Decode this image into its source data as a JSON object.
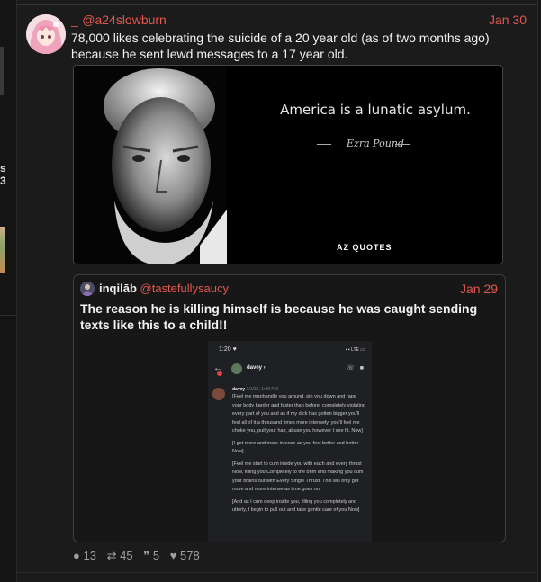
{
  "sidebar": {
    "fragment_lines": [
      "s",
      "3"
    ]
  },
  "post": {
    "prefix": "_",
    "handle": "@a24slowburn",
    "date": "Jan 30",
    "text": "78,000 likes celebrating the suicide of a 20 year old (as of two months ago) because he sent lewd messages to a 17 year old.",
    "image": {
      "quote": "America is a lunatic asylum.",
      "author": "Ezra Pound",
      "brand": "AZ QUOTES"
    }
  },
  "quoted": {
    "display_name": "inqilāb",
    "handle": "@tastefullysaucy",
    "date": "Jan 29",
    "text": "The reason he is killing himself is because he was caught sending texts like this to a child!!",
    "phone": {
      "time": "1:20",
      "network": "LTE",
      "contact": "davey",
      "sender": "davey",
      "timestamp": "1/1/25, 1:00 PM",
      "messages": [
        "[Feel me manhandle you around, pin you down and rape your body harder and faster than before, completely violating every part of you and as if my dick has gotten bigger you'll feel all of it a thousand times more intensely. you'll feel me choke you, pull your hair, abuse you however I see fit. Now]",
        "[I get more and more intense as you feel better and better Now]",
        "[Feel me start to cum inside you with each and every thrust Now, filling you Completely to the brim and making you cum your brains out with Every Single Thrust. This will only get more and more intense as time goes on]",
        "[And as I cum deep inside you, filling you completely and utterly, I begin to pull out and take gentle care of you Now]"
      ]
    }
  },
  "stats": {
    "replies": "13",
    "reposts": "45",
    "quotes": "5",
    "likes": "578"
  }
}
